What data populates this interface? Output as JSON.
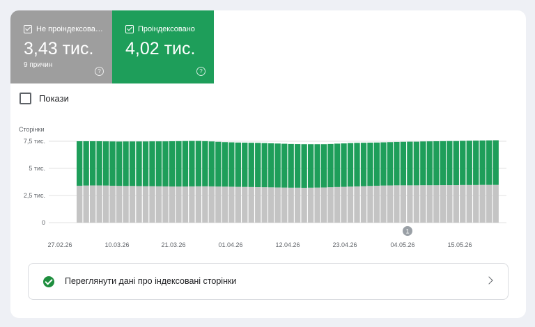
{
  "tiles": [
    {
      "label": "Не проіндексова…",
      "value": "3,43 тис.",
      "sub": "9 причин",
      "help": "?"
    },
    {
      "label": "Проіндексовано",
      "value": "4,02 тис.",
      "help": "?"
    }
  ],
  "show": {
    "label": "Покази"
  },
  "chart_data": {
    "type": "bar",
    "stacked": true,
    "ylabel": "Сторінки",
    "yticks": [
      "7,5 тис.",
      "5 тис.",
      "2,5 тис.",
      "0"
    ],
    "ylim": [
      0,
      7500
    ],
    "xticks": [
      "27.02.26",
      "10.03.26",
      "21.03.26",
      "01.04.26",
      "12.04.26",
      "23.04.26",
      "04.05.26",
      "15.05.26"
    ],
    "annotation": {
      "label": "1",
      "date": "04.05.26"
    },
    "colors": {
      "not_indexed": "#c4c4c4",
      "indexed": "#1e9e5a"
    },
    "series": [
      {
        "key": "not_indexed",
        "values": [
          3400,
          3420,
          3430,
          3430,
          3420,
          3400,
          3390,
          3380,
          3380,
          3370,
          3360,
          3360,
          3350,
          3340,
          3330,
          3330,
          3330,
          3340,
          3350,
          3350,
          3340,
          3330,
          3320,
          3310,
          3300,
          3290,
          3280,
          3270,
          3260,
          3250,
          3240,
          3230,
          3220,
          3220,
          3210,
          3220,
          3230,
          3240,
          3260,
          3280,
          3300,
          3320,
          3340,
          3360,
          3380,
          3400,
          3420,
          3430,
          3440,
          3440,
          3440,
          3440,
          3450,
          3450,
          3450,
          3460,
          3460,
          3460,
          3470,
          3470,
          3470,
          3480,
          3480,
          3480
        ]
      },
      {
        "key": "indexed",
        "values": [
          4100,
          4080,
          4070,
          4070,
          4070,
          4080,
          4080,
          4100,
          4100,
          4110,
          4120,
          4130,
          4140,
          4150,
          4170,
          4180,
          4190,
          4190,
          4180,
          4160,
          4140,
          4120,
          4100,
          4090,
          4080,
          4080,
          4080,
          4080,
          4070,
          4060,
          4050,
          4040,
          4030,
          4020,
          4020,
          4010,
          4000,
          3990,
          3990,
          4000,
          4000,
          4010,
          4010,
          4000,
          3990,
          3980,
          3980,
          3990,
          4000,
          4010,
          4020,
          4020,
          4030,
          4040,
          4050,
          4050,
          4060,
          4060,
          4070,
          4080,
          4090,
          4090,
          4100,
          4110
        ]
      }
    ]
  },
  "link": {
    "label": "Переглянути дані про індексовані сторінки"
  }
}
